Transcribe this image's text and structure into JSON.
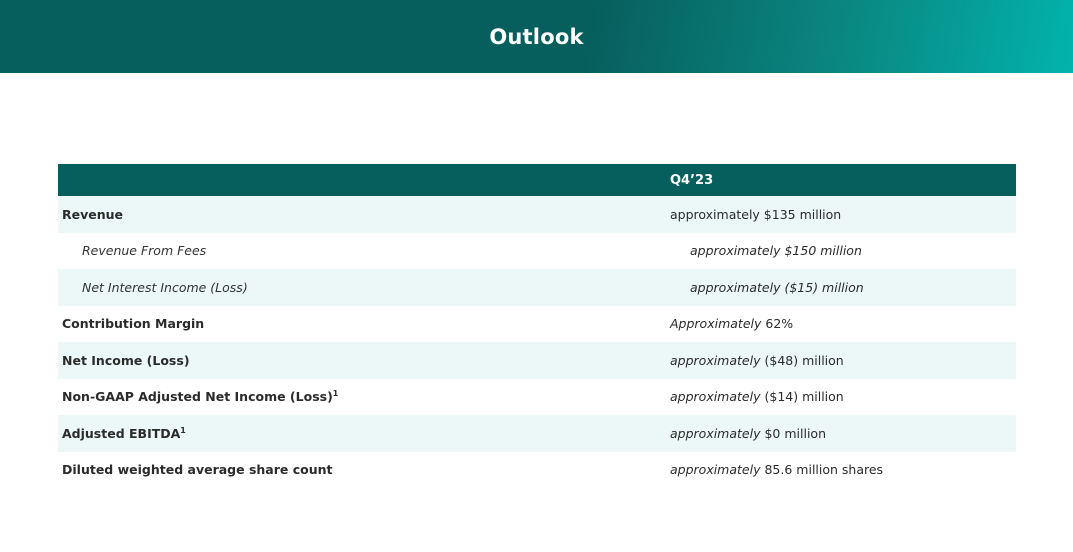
{
  "header": {
    "title": "Outlook"
  },
  "table": {
    "column_header": "Q4’23",
    "rows": [
      {
        "label": "Revenue",
        "qualifier": "",
        "value": "approximately $135 million",
        "style": "main",
        "shaded": true,
        "sup": ""
      },
      {
        "label": "Revenue From Fees",
        "qualifier": "",
        "value": "approximately $150 million",
        "style": "sub",
        "shaded": false,
        "sup": ""
      },
      {
        "label": "Net Interest Income (Loss)",
        "qualifier": "",
        "value": "approximately ($15) million",
        "style": "sub",
        "shaded": true,
        "sup": ""
      },
      {
        "label": "Contribution Margin",
        "qualifier": "Approximately",
        "value": "62%",
        "style": "main",
        "shaded": false,
        "sup": ""
      },
      {
        "label": "Net Income (Loss)",
        "qualifier": "approximately",
        "value": "($48) million",
        "style": "main",
        "shaded": true,
        "sup": ""
      },
      {
        "label": "Non-GAAP Adjusted Net Income (Loss)",
        "qualifier": "approximately",
        "value": "($14) million",
        "style": "main",
        "shaded": false,
        "sup": "1"
      },
      {
        "label": "Adjusted EBITDA",
        "qualifier": "approximately",
        "value": "$0 million",
        "style": "main",
        "shaded": true,
        "sup": "1"
      },
      {
        "label": "Diluted weighted average share count",
        "qualifier": "approximately",
        "value": "85.6 million shares",
        "style": "main",
        "shaded": false,
        "sup": ""
      }
    ]
  },
  "colors": {
    "header_dark": "#075f5d",
    "header_light": "#02b3ad",
    "row_shade": "#ebf8f7"
  }
}
